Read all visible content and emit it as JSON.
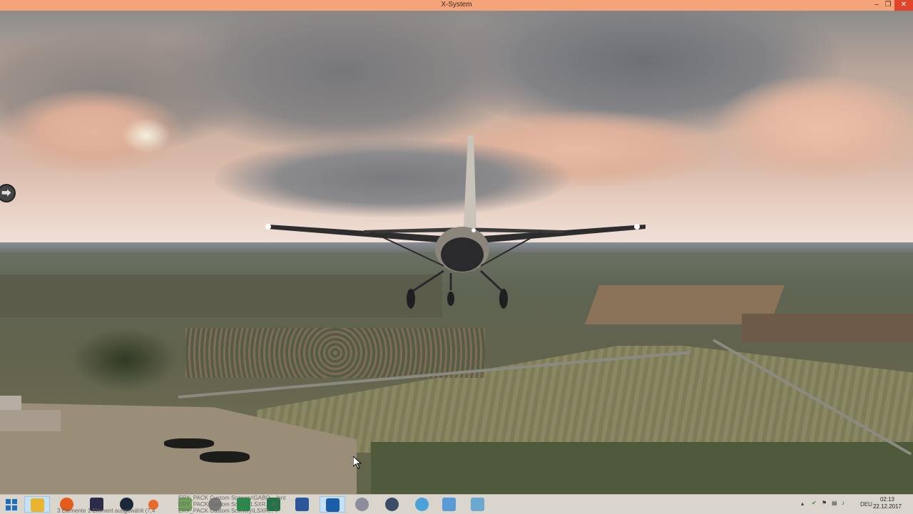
{
  "window": {
    "title": "X-System",
    "minimize": "–",
    "restore": "❐",
    "close": "✕"
  },
  "scene": {
    "nav_arrow": "⮕"
  },
  "taskbar": {
    "apps": [
      {
        "name": "start-button",
        "color": "#1e6fc2"
      },
      {
        "name": "file-explorer",
        "color": "#e8b530"
      },
      {
        "name": "firefox",
        "color": "#e55b1c"
      },
      {
        "name": "app-icon-dark",
        "color": "#2b2b4a"
      },
      {
        "name": "steam",
        "color": "#1b2838"
      },
      {
        "name": "app-icon-orange",
        "color": "#e86a2c"
      },
      {
        "name": "explorer-folder",
        "color": "#6fa25b"
      },
      {
        "name": "globe-app",
        "color": "#7a7a7a"
      },
      {
        "name": "excel-green",
        "color": "#1f8f48"
      },
      {
        "name": "excel",
        "color": "#217346"
      },
      {
        "name": "word",
        "color": "#2b579a"
      },
      {
        "name": "x-plane",
        "color": "#1b5ea8"
      },
      {
        "name": "satellite-app",
        "color": "#8c8c9c"
      },
      {
        "name": "globe-app-2",
        "color": "#3b4d66"
      },
      {
        "name": "plane-app",
        "color": "#4aa2d8"
      },
      {
        "name": "image-app",
        "color": "#5b9bd5"
      },
      {
        "name": "notes-app",
        "color": "#6aa8d0"
      }
    ],
    "labels": {
      "l1": "ERY_PACK Custom Scenery\\GABO... lent",
      "l2": "ERY_PACK Custom Scener/LSXR... E/",
      "l3": "ERY_PACK Custom Scenery\\LSXR... T"
    },
    "small_labels": {
      "s1": "3 Elemente   1 Element ausgewählt (7,4"
    },
    "tray": {
      "language": "DEU"
    },
    "clock": {
      "time": "02:13",
      "date": "22.12.2017"
    }
  }
}
